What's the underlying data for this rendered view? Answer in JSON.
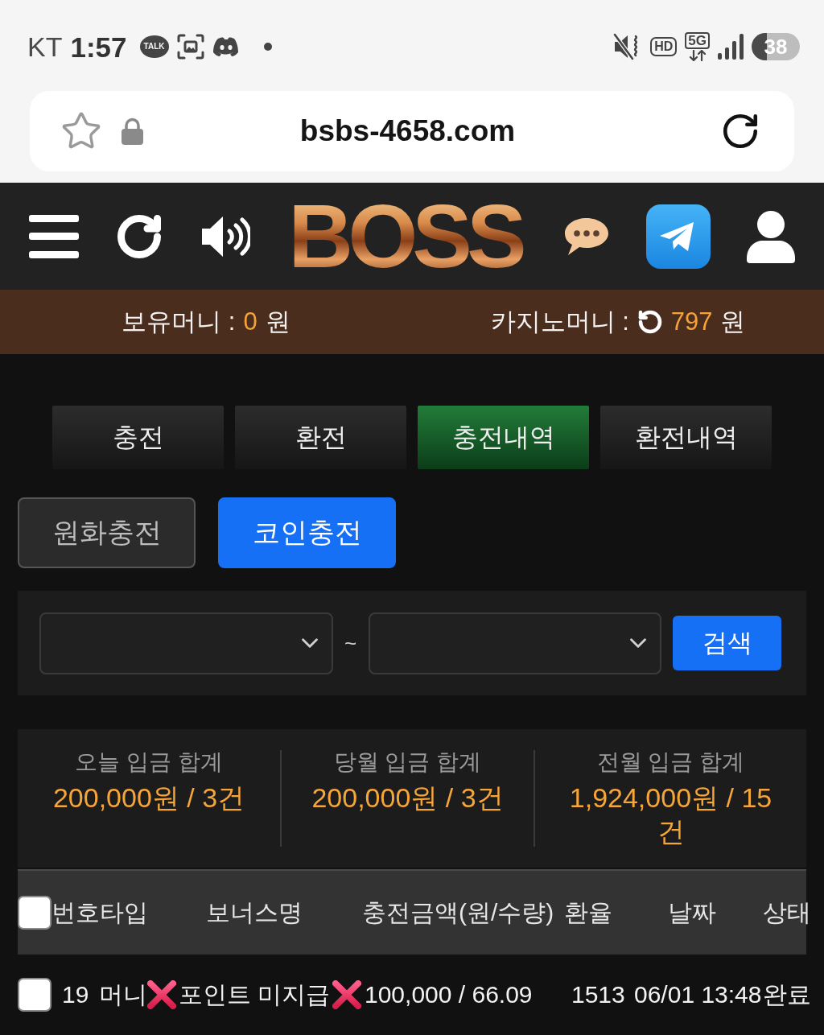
{
  "status_bar": {
    "carrier": "KT",
    "time": "1:57",
    "talk_badge": "TALK",
    "hd_badge": "HD",
    "network": "5G",
    "battery": "38"
  },
  "address_bar": {
    "url": "bsbs-4658.com"
  },
  "header": {
    "logo": "BOSS"
  },
  "balances": [
    {
      "kind": "wallet",
      "label": "보유머니 :",
      "amount": "0",
      "unit": "원"
    },
    {
      "kind": "casino",
      "label": "카지노머니 :",
      "amount": "797",
      "unit": "원"
    }
  ],
  "tabs": [
    {
      "label": "충전",
      "selected": false
    },
    {
      "label": "환전",
      "selected": false
    },
    {
      "label": "충전내역",
      "selected": true
    },
    {
      "label": "환전내역",
      "selected": false
    }
  ],
  "subtabs": [
    {
      "label": "원화충전",
      "selected": false
    },
    {
      "label": "코인충전",
      "selected": true
    }
  ],
  "search": {
    "separator": "~",
    "button": "검색"
  },
  "summary": [
    {
      "label": "오늘 입금 합계",
      "value": "200,000원 / 3건"
    },
    {
      "label": "당월 입금 합계",
      "value": "200,000원 / 3건"
    },
    {
      "label": "전월 입금 합계",
      "value": "1,924,000원 / 15건"
    }
  ],
  "table": {
    "select_all": {
      "checked": false
    },
    "columns": [
      "번호",
      "타입",
      "보너스명",
      "충전금액(원/수량)",
      "환율",
      "날짜",
      "상태"
    ],
    "rows": [
      {
        "checked": false,
        "cells": [
          "19",
          "머니",
          "포인트 미지급",
          "100,000 / 66.09",
          "1513",
          "06/01 13:48",
          "완료"
        ]
      }
    ]
  }
}
